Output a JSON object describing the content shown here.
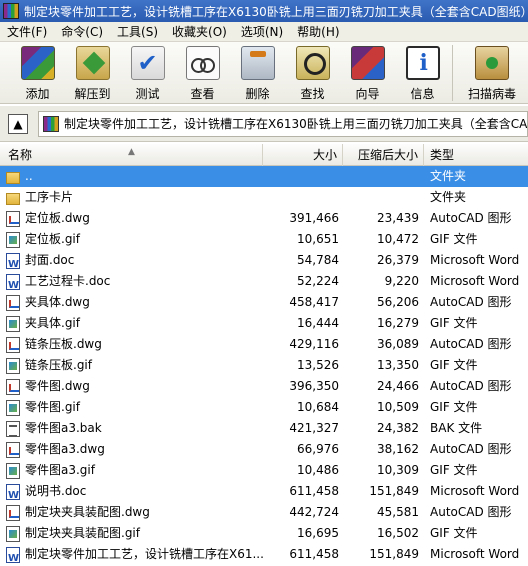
{
  "window": {
    "title": "制定块零件加工工艺，设计铣槽工序在X6130卧铣上用三面刃铣刀加工夹具（全套含CAD图纸）"
  },
  "menu": [
    "文件(F)",
    "命令(C)",
    "工具(S)",
    "收藏夹(O)",
    "选项(N)",
    "帮助(H)"
  ],
  "toolbar": {
    "add": "添加",
    "extract": "解压到",
    "test": "测试",
    "view": "查看",
    "delete": "删除",
    "find": "查找",
    "wizard": "向导",
    "info": "信息",
    "virus": "扫描病毒"
  },
  "address": {
    "path": "制定块零件加工工艺，设计铣槽工序在X6130卧铣上用三面刃铣刀加工夹具（全套含CAD图纸）"
  },
  "columns": {
    "name": "名称",
    "size": "大小",
    "packed": "压缩后大小",
    "type": "类型"
  },
  "files": [
    {
      "name": "..",
      "size": "",
      "packed": "",
      "type": "文件夹",
      "icon": "folder",
      "selected": true
    },
    {
      "name": "工序卡片",
      "size": "",
      "packed": "",
      "type": "文件夹",
      "icon": "folder"
    },
    {
      "name": "定位板.dwg",
      "size": "391,466",
      "packed": "23,439",
      "type": "AutoCAD 图形",
      "icon": "dwg"
    },
    {
      "name": "定位板.gif",
      "size": "10,651",
      "packed": "10,472",
      "type": "GIF 文件",
      "icon": "gif"
    },
    {
      "name": "封面.doc",
      "size": "54,784",
      "packed": "26,379",
      "type": "Microsoft Word",
      "icon": "doc"
    },
    {
      "name": "工艺过程卡.doc",
      "size": "52,224",
      "packed": "9,220",
      "type": "Microsoft Word",
      "icon": "doc"
    },
    {
      "name": "夹具体.dwg",
      "size": "458,417",
      "packed": "56,206",
      "type": "AutoCAD 图形",
      "icon": "dwg"
    },
    {
      "name": "夹具体.gif",
      "size": "16,444",
      "packed": "16,279",
      "type": "GIF 文件",
      "icon": "gif"
    },
    {
      "name": "链条压板.dwg",
      "size": "429,116",
      "packed": "36,089",
      "type": "AutoCAD 图形",
      "icon": "dwg"
    },
    {
      "name": "链条压板.gif",
      "size": "13,526",
      "packed": "13,350",
      "type": "GIF 文件",
      "icon": "gif"
    },
    {
      "name": "零件图.dwg",
      "size": "396,350",
      "packed": "24,466",
      "type": "AutoCAD 图形",
      "icon": "dwg"
    },
    {
      "name": "零件图.gif",
      "size": "10,684",
      "packed": "10,509",
      "type": "GIF 文件",
      "icon": "gif"
    },
    {
      "name": "零件图a3.bak",
      "size": "421,327",
      "packed": "24,382",
      "type": "BAK 文件",
      "icon": "bak"
    },
    {
      "name": "零件图a3.dwg",
      "size": "66,976",
      "packed": "38,162",
      "type": "AutoCAD 图形",
      "icon": "dwg"
    },
    {
      "name": "零件图a3.gif",
      "size": "10,486",
      "packed": "10,309",
      "type": "GIF 文件",
      "icon": "gif"
    },
    {
      "name": "说明书.doc",
      "size": "611,458",
      "packed": "151,849",
      "type": "Microsoft Word",
      "icon": "doc"
    },
    {
      "name": "制定块夹具装配图.dwg",
      "size": "442,724",
      "packed": "45,581",
      "type": "AutoCAD 图形",
      "icon": "dwg"
    },
    {
      "name": "制定块夹具装配图.gif",
      "size": "16,695",
      "packed": "16,502",
      "type": "GIF 文件",
      "icon": "gif"
    },
    {
      "name": "制定块零件加工工艺，设计铣槽工序在X61...",
      "size": "611,458",
      "packed": "151,849",
      "type": "Microsoft Word",
      "icon": "doc"
    }
  ]
}
